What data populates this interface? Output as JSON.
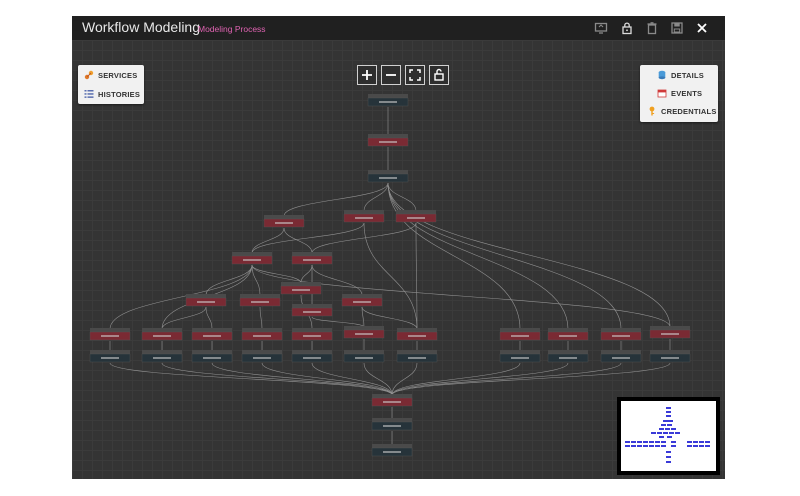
{
  "window": {
    "title": "Workflow Modeling",
    "subtitle": "Modeling Process"
  },
  "left_panel": {
    "items": [
      {
        "label": "SERVICES",
        "icon": "services-icon"
      },
      {
        "label": "HISTORIES",
        "icon": "histories-icon"
      }
    ]
  },
  "right_panel": {
    "items": [
      {
        "label": "DETAILS",
        "icon": "database-icon"
      },
      {
        "label": "EVENTS",
        "icon": "calendar-icon"
      },
      {
        "label": "CREDENTIALS",
        "icon": "key-icon"
      }
    ]
  },
  "toolbar": {
    "buttons": [
      "zoom-in",
      "zoom-out",
      "fit-to-screen",
      "unlock"
    ]
  },
  "titlebar_icons": [
    "monitor-icon",
    "lock-icon",
    "trash-icon",
    "save-icon",
    "close-icon"
  ],
  "colors": {
    "titlebar": "#202020",
    "canvas": "#343434",
    "subtitle": "#e063b2",
    "node_red": "#7a2a33",
    "node_dark": "#26333a",
    "minimap_node": "#3a3ad8"
  }
}
